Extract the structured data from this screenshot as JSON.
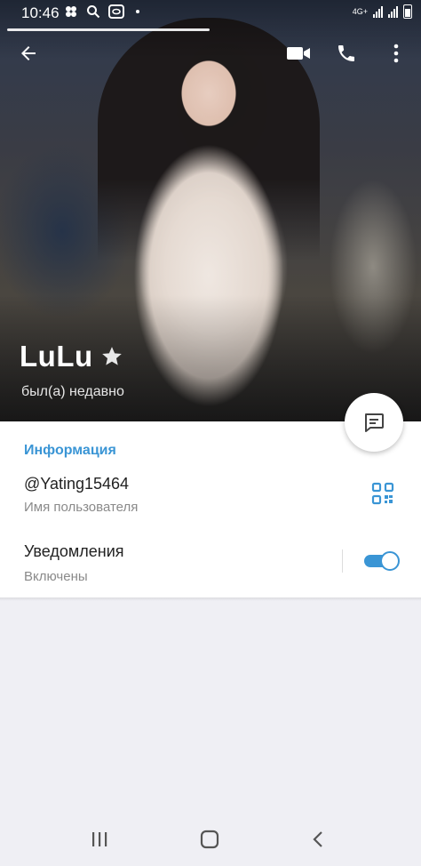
{
  "status_bar": {
    "time": "10:46",
    "network": "4G+",
    "icons": [
      "flower-icon",
      "search-icon",
      "app-icon",
      "dot-icon",
      "signal-icon",
      "battery-icon"
    ]
  },
  "header": {
    "name": "LuLu",
    "last_seen": "был(а) недавно",
    "actions": [
      "back-arrow-icon",
      "video-call-icon",
      "phone-icon",
      "more-vert-icon"
    ]
  },
  "info": {
    "section_title": "Информация",
    "username": "@Yating15464",
    "username_label": "Имя пользователя",
    "notifications_label": "Уведомления",
    "notifications_state": "Включены",
    "notifications_on": true
  },
  "colors": {
    "accent": "#3a95d5",
    "background": "#efeff4",
    "card": "#ffffff"
  }
}
